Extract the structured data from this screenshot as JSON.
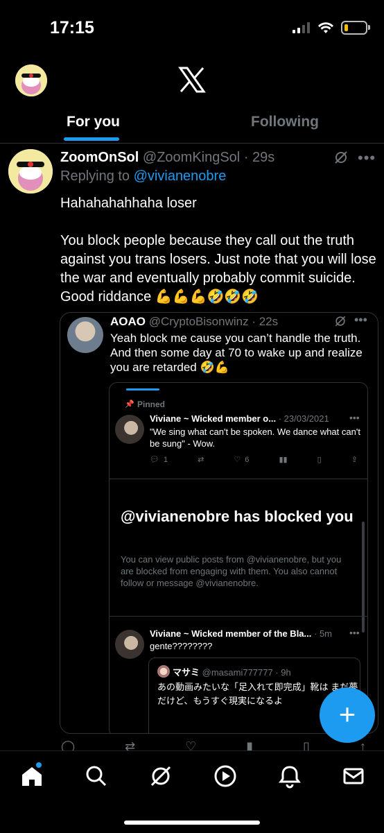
{
  "status": {
    "time": "17:15"
  },
  "header": {
    "logo_icon": "x-logo-icon"
  },
  "tabs": [
    {
      "label": "For you",
      "active": true
    },
    {
      "label": "Following",
      "active": false
    }
  ],
  "tweet": {
    "display_name": "ZoomOnSol",
    "handle": "@ZoomKingSol",
    "time": "· 29s",
    "replying_prefix": "Replying to ",
    "replying_to": "@vivianenobre",
    "line1": "Hahahahahhaha loser",
    "line2": "You block people because they call out the truth against you trans losers. Just note that you will lose the war and eventually probably commit suicide. Good riddance 💪💪💪🤣🤣🤣"
  },
  "quote": {
    "display_name": "AOAO",
    "handle": "@CryptoBisonwinz",
    "time": "· 22s",
    "text": "Yeah block me cause you can’t handle the truth. And then some day at 70 to wake up and realize you are retarded 🤣💪",
    "embedded": {
      "pinned_label": "Pinned",
      "pinned_tweet": {
        "display_name": "Viviane ~ Wicked member o...",
        "time": "· 23/03/2021",
        "text": "\"We sing what can't be spoken. We dance what can't be sung\" - Wow.",
        "replies": "1",
        "likes": "6"
      },
      "blocked_title": "@vivianenobre has blocked you",
      "blocked_desc": "You can view public posts from @vivianenobre, but you are blocked from engaging with them. You also cannot follow or message @vivianenobre.",
      "second_tweet": {
        "display_name": "Viviane ~ Wicked member of the Bla...",
        "time": "· 5m",
        "text": "gente????????",
        "nested": {
          "display_name": "マサミ",
          "handle": "@masami777777",
          "time": "· 9h",
          "text": "あの動画みたいな「足入れて即完成」靴は まだ夢だけど、もうすぐ現実になるよ"
        }
      }
    }
  },
  "fab_label": "+",
  "colors": {
    "accent": "#1d9bf0",
    "background": "#000000",
    "muted": "#71767b"
  }
}
